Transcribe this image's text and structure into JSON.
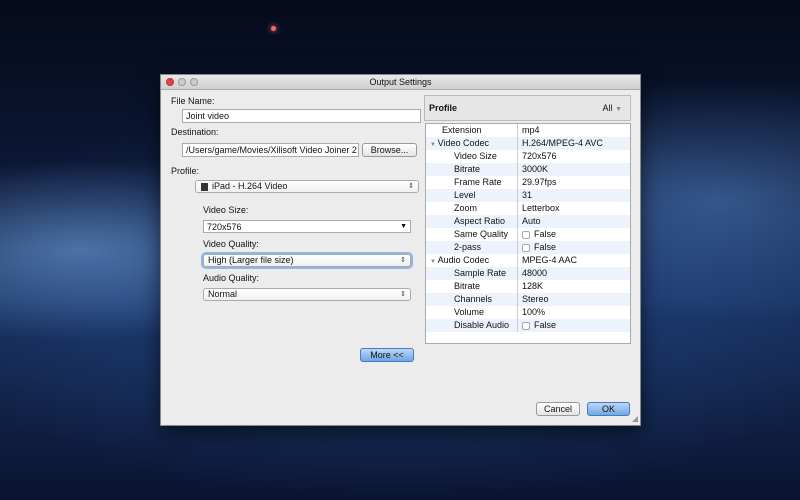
{
  "window": {
    "title": "Output Settings"
  },
  "left": {
    "file_name_label": "File Name:",
    "file_name_value": "Joint video",
    "destination_label": "Destination:",
    "destination_value": "/Users/game/Movies/Xilisoft Video Joiner 2",
    "browse_label": "Browse...",
    "profile_label": "Profile:",
    "profile_value": "iPad - H.264 Video",
    "video_size_label": "Video Size:",
    "video_size_value": "720x576",
    "video_quality_label": "Video Quality:",
    "video_quality_value": "High (Larger file size)",
    "audio_quality_label": "Audio Quality:",
    "audio_quality_value": "Normal",
    "more_label": "More <<"
  },
  "right": {
    "header": "Profile",
    "filter": "All",
    "rows": [
      {
        "key": "Extension",
        "value": "mp4",
        "level": 0
      },
      {
        "key": "Video Codec",
        "value": "H.264/MPEG-4 AVC",
        "level": 0,
        "group": true
      },
      {
        "key": "Video Size",
        "value": "720x576",
        "level": 1
      },
      {
        "key": "Bitrate",
        "value": "3000K",
        "level": 1
      },
      {
        "key": "Frame Rate",
        "value": "29.97fps",
        "level": 1
      },
      {
        "key": "Level",
        "value": "31",
        "level": 1
      },
      {
        "key": "Zoom",
        "value": "Letterbox",
        "level": 1
      },
      {
        "key": "Aspect Ratio",
        "value": "Auto",
        "level": 1
      },
      {
        "key": "Same Quality",
        "value": "False",
        "level": 1,
        "checkbox": true
      },
      {
        "key": "2-pass",
        "value": "False",
        "level": 1,
        "checkbox": true
      },
      {
        "key": "Audio Codec",
        "value": "MPEG-4 AAC",
        "level": 0,
        "group": true
      },
      {
        "key": "Sample Rate",
        "value": "48000",
        "level": 1
      },
      {
        "key": "Bitrate",
        "value": "128K",
        "level": 1
      },
      {
        "key": "Channels",
        "value": "Stereo",
        "level": 1
      },
      {
        "key": "Volume",
        "value": "100%",
        "level": 1
      },
      {
        "key": "Disable Audio",
        "value": "False",
        "level": 1,
        "checkbox": true
      }
    ]
  },
  "footer": {
    "cancel": "Cancel",
    "ok": "OK"
  }
}
